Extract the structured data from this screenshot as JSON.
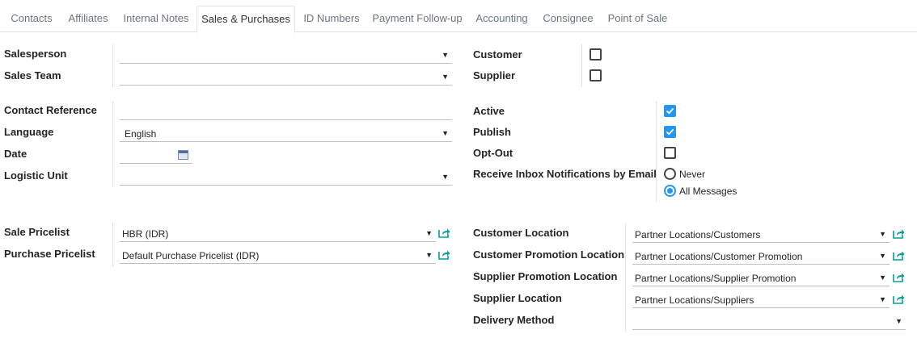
{
  "tabs": [
    {
      "label": "Contacts",
      "active": false
    },
    {
      "label": "Affiliates",
      "active": false
    },
    {
      "label": "Internal Notes",
      "active": false
    },
    {
      "label": "Sales & Purchases",
      "active": true
    },
    {
      "label": "ID Numbers",
      "active": false
    },
    {
      "label": "Payment Follow-up",
      "active": false
    },
    {
      "label": "Accounting",
      "active": false
    },
    {
      "label": "Consignee",
      "active": false
    },
    {
      "label": "Point of Sale",
      "active": false
    }
  ],
  "sales": {
    "salesperson": {
      "label": "Salesperson",
      "value": ""
    },
    "sales_team": {
      "label": "Sales Team",
      "value": ""
    }
  },
  "roles": {
    "customer": {
      "label": "Customer",
      "checked": false
    },
    "supplier": {
      "label": "Supplier",
      "checked": false
    }
  },
  "misc": {
    "contact_reference": {
      "label": "Contact Reference",
      "value": ""
    },
    "language": {
      "label": "Language",
      "value": "English"
    },
    "date": {
      "label": "Date",
      "value": ""
    },
    "logistic_unit": {
      "label": "Logistic Unit",
      "value": ""
    }
  },
  "flags": {
    "active": {
      "label": "Active",
      "checked": true
    },
    "publish": {
      "label": "Publish",
      "checked": true
    },
    "opt_out": {
      "label": "Opt-Out",
      "checked": false
    }
  },
  "notifications": {
    "label": "Receive Inbox Notifications by Email",
    "options": [
      {
        "label": "Never",
        "selected": false
      },
      {
        "label": "All Messages",
        "selected": true
      }
    ]
  },
  "pricelists": {
    "sale": {
      "label": "Sale Pricelist",
      "value": "HBR (IDR)"
    },
    "purchase": {
      "label": "Purchase Pricelist",
      "value": "Default Purchase Pricelist (IDR)"
    }
  },
  "locations": {
    "customer": {
      "label": "Customer Location",
      "value": "Partner Locations/Customers"
    },
    "customer_promotion": {
      "label": "Customer Promotion Location",
      "value": "Partner Locations/Customer Promotion"
    },
    "supplier_promotion": {
      "label": "Supplier Promotion Location",
      "value": "Partner Locations/Supplier Promotion"
    },
    "supplier": {
      "label": "Supplier Location",
      "value": "Partner Locations/Suppliers"
    },
    "delivery_method": {
      "label": "Delivery Method",
      "value": ""
    }
  },
  "icons": {
    "dropdown": "caret-down-icon",
    "external": "external-link-icon",
    "calendar": "calendar-icon"
  },
  "colors": {
    "accent": "#2196f3",
    "external_icon": "#00a09d"
  }
}
